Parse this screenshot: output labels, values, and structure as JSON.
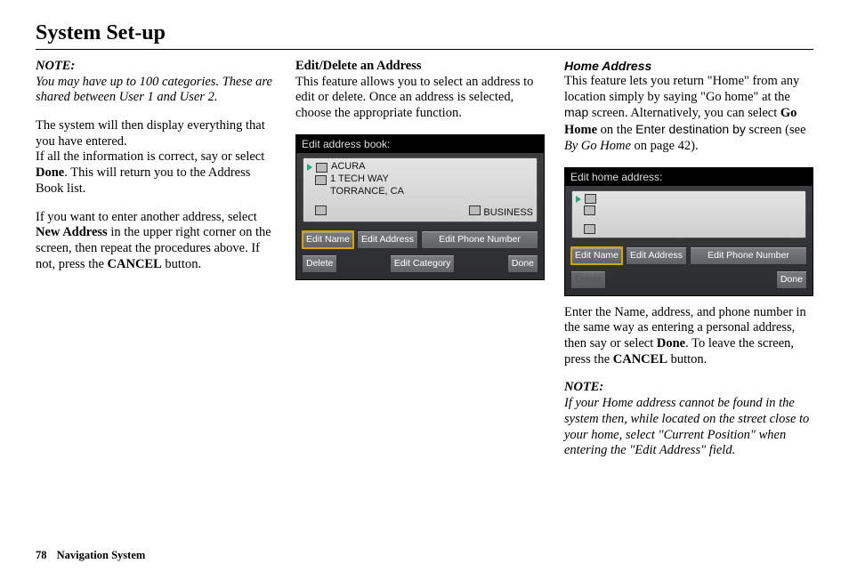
{
  "title": "System Set-up",
  "col1": {
    "note_label": "NOTE:",
    "note_body": "You may have up to 100 categories. These are shared between User 1 and User 2.",
    "p1a": "The system will then display everything that you have entered.",
    "p1b_pre": "If all the information is correct, say or select ",
    "p1b_bold": "Done",
    "p1b_post": ". This will return you to the Address Book list.",
    "p2_pre": "If you want to enter another address, select ",
    "p2_bold": "New Address",
    "p2_mid": " in the upper right corner on the screen, then repeat the procedures above. If not, press the ",
    "p2_bold2": "CANCEL",
    "p2_post": " button."
  },
  "col2": {
    "heading": "Edit/Delete an Address",
    "p1": "This feature allows you to select an address to edit or delete. Once an address is selected, choose the appropriate function.",
    "dev": {
      "title": "Edit address book:",
      "row1": "ACURA",
      "row2a": "1 TECH WAY",
      "row2b": "TORRANCE, CA",
      "row3_right": "BUSINESS",
      "btns1": {
        "a": "Edit Name",
        "b": "Edit Address",
        "c": "Edit Phone Number"
      },
      "btns2": {
        "a": "Delete",
        "b": "Edit Category",
        "c": "Done"
      }
    }
  },
  "col3": {
    "heading": "Home Address",
    "p1_pre": "This feature lets you return \"Home\" from any location simply by saying \"Go home\" at the ",
    "p1_sans1": "map",
    "p1_mid1": " screen. Alternatively, you can select ",
    "p1_bold": "Go Home",
    "p1_mid2": " on the ",
    "p1_sans2": "Enter destination by",
    "p1_mid3": " screen (see ",
    "p1_ital": "By Go Home",
    "p1_post": " on page 42).",
    "dev": {
      "title": "Edit home address:",
      "btns1": {
        "a": "Edit Name",
        "b": "Edit Address",
        "c": "Edit Phone Number"
      },
      "btns2": {
        "a": "Delete",
        "c": "Done"
      }
    },
    "p2_pre": "Enter the Name, address, and phone number in the same way as entering a personal address, then say or select ",
    "p2_bold": "Done",
    "p2_mid": ". To leave the screen, press the ",
    "p2_bold2": "CANCEL",
    "p2_post": " button.",
    "note_label": "NOTE:",
    "note_body": "If your Home address cannot be found in the system then, while located on the street close to your home, select \"Current Position\" when entering the \"Edit Address\" field."
  },
  "footer": {
    "page": "78",
    "label": "Navigation System"
  }
}
